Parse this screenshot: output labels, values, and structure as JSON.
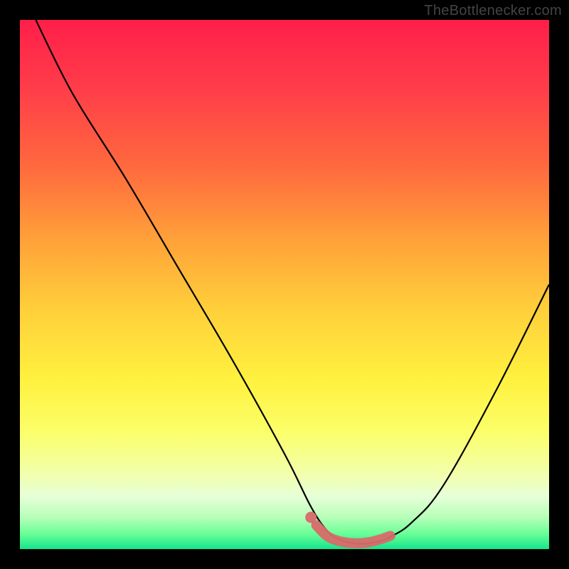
{
  "watermark": "TheBottlenecker.com",
  "colors": {
    "background": "#000000",
    "curve": "#000000",
    "marker": "#d86a6a"
  },
  "chart_data": {
    "type": "line",
    "title": "",
    "xlabel": "",
    "ylabel": "",
    "xlim": [
      0,
      100
    ],
    "ylim": [
      0,
      100
    ],
    "series": [
      {
        "name": "curve",
        "x": [
          3,
          10,
          20,
          30,
          40,
          50,
          55,
          58,
          60,
          62,
          64,
          66,
          68,
          70,
          74,
          80,
          90,
          100
        ],
        "y": [
          100,
          86,
          70,
          53,
          36,
          18,
          8,
          3.5,
          2,
          1.3,
          1,
          1.1,
          1.5,
          2.3,
          5,
          12,
          30,
          50
        ]
      }
    ],
    "annotations": [
      {
        "name": "optimal-range-marker",
        "x": [
          56,
          58,
          60,
          62,
          64,
          66,
          68,
          70
        ],
        "y": [
          4.5,
          2.5,
          1.6,
          1.2,
          1.1,
          1.3,
          1.8,
          2.5
        ]
      },
      {
        "name": "optimal-range-dot",
        "x": 55,
        "y": 6
      }
    ],
    "gradient_stops": [
      {
        "pos": 0,
        "color": "#ff1f4a"
      },
      {
        "pos": 28,
        "color": "#ff6a3e"
      },
      {
        "pos": 55,
        "color": "#ffd03a"
      },
      {
        "pos": 78,
        "color": "#fbff6a"
      },
      {
        "pos": 94,
        "color": "#b7ffb9"
      },
      {
        "pos": 100,
        "color": "#15e58c"
      }
    ]
  }
}
